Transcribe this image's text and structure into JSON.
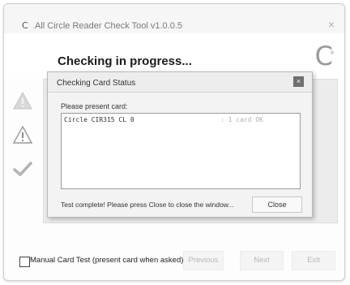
{
  "window": {
    "title": "All Circle Reader Check Tool v1.0.0.5",
    "app_icon": "C",
    "close_glyph": "×"
  },
  "header": {
    "heading": "Checking in progress...",
    "brand_logo": "C",
    "brand_mark": "®"
  },
  "steps": [
    {
      "icon": "warning-triangle-icon",
      "state": "done"
    },
    {
      "icon": "warning-triangle-icon",
      "state": "active"
    },
    {
      "icon": "checkmark-icon",
      "state": "pending"
    }
  ],
  "dialog": {
    "title": "Checking Card Status",
    "close_glyph": "×",
    "prompt": "Please present card:",
    "readers": [
      {
        "name": "Circle CIR315 CL 0",
        "status": ": 1 card OK"
      }
    ],
    "message": "Test complete! Please press Close to close the window...",
    "close_label": "Close"
  },
  "footer": {
    "manual_test_label": "Manual Card Test (present card when asked)",
    "manual_test_checked": false,
    "previous_label": "Previous",
    "next_label": "Next",
    "exit_label": "Exit"
  },
  "colors": {
    "disabled_text": "#b7b7b7",
    "dialog_close_bg": "#6f6f6f"
  }
}
